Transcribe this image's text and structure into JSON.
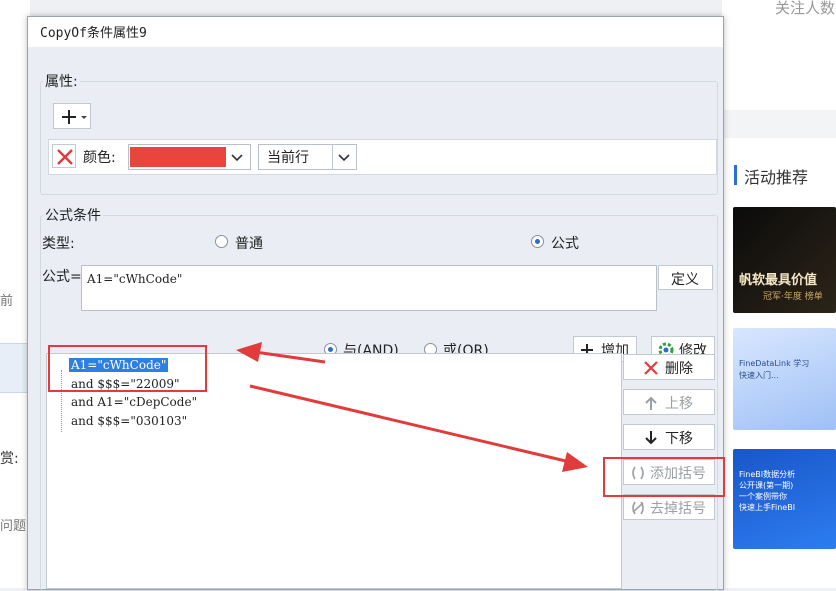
{
  "background": {
    "left_texts": [
      "前",
      "赏:",
      "问题"
    ],
    "follow_text": "关注人数",
    "section_title": "活动推荐",
    "banner1": {
      "title": "帆软最具价值",
      "subtitle": "冠军·年度 榜单"
    },
    "banner2": {
      "lines": [
        "FineDataLink 学习",
        "快速入门..."
      ]
    },
    "banner3": {
      "lines": [
        "FineBI数据分析",
        "公开课(第一期)",
        "一个案例带你",
        "快速上手FineBI"
      ]
    }
  },
  "dialog": {
    "title": "CopyOf条件属性9",
    "attributes": {
      "group_label": "属性:",
      "add_icon": "plus-icon",
      "color_label": "颜色:",
      "color_value": "#e8453c",
      "scope_value": "当前行"
    },
    "formula_condition": {
      "group_label": "公式条件",
      "type_label": "类型:",
      "type_normal": "普通",
      "type_formula": "公式",
      "formula_label": "公式=",
      "formula_value": "A1=\"cWhCode\"",
      "define_button": "定义"
    },
    "logic": {
      "and_label": "与(AND)",
      "or_label": "或(OR)",
      "add_button": "增加",
      "modify_button": "修改"
    },
    "conditions": [
      "A1=\"cWhCode\"",
      "and $$$=\"22009\"",
      "and A1=\"cDepCode\"",
      "and $$$=\"030103\""
    ],
    "side_buttons": {
      "delete": "删除",
      "move_up": "上移",
      "move_down": "下移",
      "add_bracket": "添加括号",
      "remove_bracket": "去掉括号"
    },
    "annotation_color": "#e23b3b"
  }
}
